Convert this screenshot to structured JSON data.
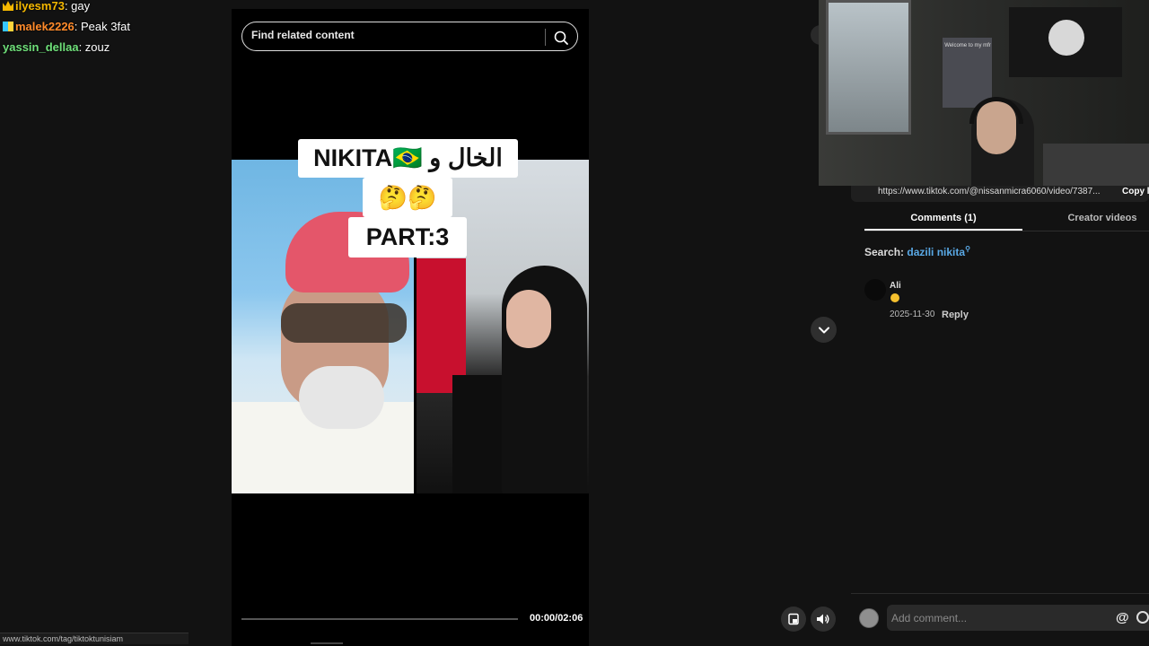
{
  "chat": {
    "messages": [
      {
        "user": "ilyesm73",
        "text": "gay",
        "color": "#f5b800"
      },
      {
        "user": "malek2226",
        "text": "Peak 3fat",
        "color": "#ff8a2a"
      },
      {
        "user": "yassin_dellaa",
        "text": "zouz",
        "color": "#6fe07a"
      }
    ],
    "status_url": "www.tiktok.com/tag/tiktoktunisiam"
  },
  "video": {
    "search_placeholder": "Find related content",
    "caption_line1": "NIKITA🇧🇷 الخال و",
    "caption_line2": "🤔🤔",
    "caption_line3": "PART:3",
    "time": "00:00/02:06",
    "progress": 0.0
  },
  "right_panel": {
    "url": "https://www.tiktok.com/@nissanmicra6060/video/7387...",
    "copy_label": "Copy l",
    "tabs": [
      {
        "label": "Comments (1)",
        "active": true
      },
      {
        "label": "Creator videos",
        "active": false
      }
    ],
    "search_prefix": "Search:",
    "search_term": "dazili nikita",
    "comment": {
      "user": "Ali",
      "date": "2025-11-30",
      "reply_label": "Reply"
    },
    "add_comment_placeholder": "Add comment...",
    "at_label": "@"
  },
  "webcam": {
    "poster_text": "Welcome to my mfr"
  },
  "icons": {
    "search": "search-icon",
    "chevron": "chevron-down-icon",
    "pip": "picture-in-picture-icon",
    "volume": "volume-icon",
    "emoji": "emoji-icon"
  },
  "colors": {
    "background": "#121212",
    "accent_link": "#5aa9e6"
  }
}
